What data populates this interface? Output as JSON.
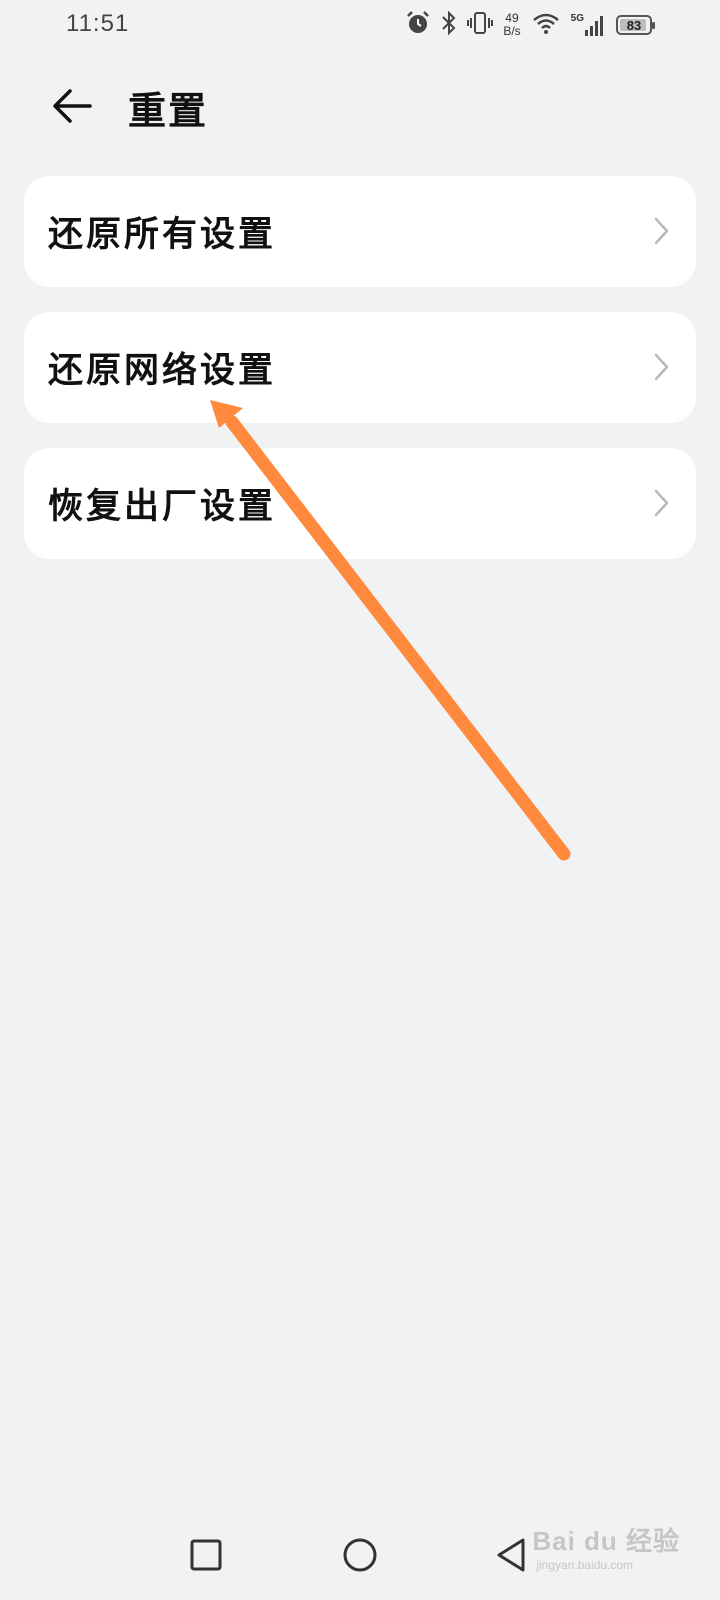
{
  "status_bar": {
    "time": "11:51",
    "net_speed_value": "49",
    "net_speed_unit": "B/s",
    "network_type": "5G",
    "battery_level": "83",
    "icons": [
      "alarm-icon",
      "bluetooth-icon",
      "vibrate-icon",
      "wifi-icon",
      "signal-icon",
      "battery-icon"
    ]
  },
  "header": {
    "back_icon": "arrow-left-icon",
    "title": "重置"
  },
  "list": {
    "items": [
      {
        "label": "还原所有设置"
      },
      {
        "label": "还原网络设置"
      },
      {
        "label": "恢复出厂设置"
      }
    ]
  },
  "annotation": {
    "arrow_color": "#ff8a3d"
  },
  "nav_bar": {
    "icons": [
      "recents-square-icon",
      "home-circle-icon",
      "back-triangle-icon"
    ]
  },
  "watermark": {
    "main": "Bai du 经验",
    "sub": "jingyan.baidu.com"
  }
}
